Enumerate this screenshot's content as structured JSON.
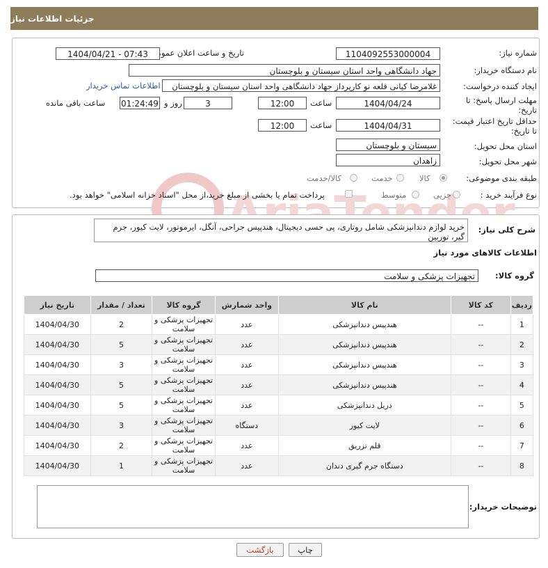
{
  "header": {
    "title": "جزئیات اطلاعات نیاز"
  },
  "form": {
    "need_number_label": "شماره نیاز:",
    "need_number": "1104092553000004",
    "announce_label": "تاریخ و ساعت اعلان عمومی:",
    "announce_value": "1404/04/21 - 07:43",
    "buyer_org_label": "نام دستگاه خریدار:",
    "buyer_org": "جهاد دانشگاهی واحد استان سیستان و بلوچستان",
    "creator_label": "ایجاد کننده درخواست:",
    "creator": "غلامرضا کیانی قلعه نو کارپرداز جهاد دانشگاهی واحد استان سیستان و بلوچستان",
    "contact_link": "اطلاعات تماس خریدار",
    "deadline_label_1": "مهلت ارسال پاسخ: تا",
    "deadline_label_2": "تاریخ:",
    "deadline_date": "1404/04/24",
    "time_label": "ساعت",
    "deadline_time": "12:00",
    "days_value": "3",
    "days_label": "روز و",
    "remaining_time": "01:24:49",
    "remaining_label": "ساعت باقی مانده",
    "min_price_label_1": "حداقل تاریخ اعتبار قیمت:",
    "min_price_label_2": "تا تاریخ:",
    "min_price_date": "1404/04/31",
    "min_price_time": "12:00",
    "province_label": "استان محل تحویل:",
    "province": "سیستان و بلوچستان",
    "city_label": "شهر محل تحویل:",
    "city": "زاهدان",
    "category_label": "طبقه بندی موضوعی:",
    "category_options": [
      "کالا",
      "خدمت",
      "کالا/خدمت"
    ],
    "category_selected": "کالا",
    "process_label": "نوع فرآیند خرید :",
    "process_options": [
      "جزیی",
      "متوسط"
    ],
    "payment_note": "پرداخت تمام یا بخشی از مبلغ خرید،از محل \"اسناد خزانه اسلامی\" خواهد بود."
  },
  "description": {
    "label": "شرح کلی نیاز:",
    "text": "خرید لوازم دندانپزشکی شامل روتاری، پی حسی دیجیتال، هندپیس جراحی، آنگل، ایرموتور، لایت کیور، جرم گیر، توربین"
  },
  "goods": {
    "section_title": "اطلاعات کالاهای مورد نیاز",
    "group_label": "گروه کالا:",
    "group_value": "تجهیزات پزشکی و سلامت",
    "columns": [
      "ردیف",
      "کد کالا",
      "نام کالا",
      "واحد شمارش",
      "گروه کالا",
      "تعداد / مقدار",
      "تاریخ نیاز"
    ],
    "rows": [
      {
        "idx": "1",
        "code": "--",
        "name": "هندپیس دندانپزشکی",
        "unit": "عدد",
        "group": "تجهیزات پزشکی و سلامت",
        "qty": "2",
        "date": "1404/04/30"
      },
      {
        "idx": "2",
        "code": "--",
        "name": "هندپیس دندانپزشکی",
        "unit": "عدد",
        "group": "تجهیزات پزشکی و سلامت",
        "qty": "5",
        "date": "1404/04/30"
      },
      {
        "idx": "3",
        "code": "--",
        "name": "هندپیس دندانپزشکی",
        "unit": "عدد",
        "group": "تجهیزات پزشکی و سلامت",
        "qty": "3",
        "date": "1404/04/30"
      },
      {
        "idx": "4",
        "code": "--",
        "name": "هندپیس دندانپزشکی",
        "unit": "عدد",
        "group": "تجهیزات پزشکی و سلامت",
        "qty": "5",
        "date": "1404/04/30"
      },
      {
        "idx": "5",
        "code": "--",
        "name": "دریل دندانپزشکی",
        "unit": "عدد",
        "group": "تجهیزات پزشکی و سلامت",
        "qty": "5",
        "date": "1404/04/30"
      },
      {
        "idx": "6",
        "code": "--",
        "name": "لایت کیور",
        "unit": "دستگاه",
        "group": "تجهیزات پزشکی و سلامت",
        "qty": "3",
        "date": "1404/04/30"
      },
      {
        "idx": "7",
        "code": "--",
        "name": "قلم تزریق",
        "unit": "عدد",
        "group": "تجهیزات پزشکی و سلامت",
        "qty": "2",
        "date": "1404/04/30"
      },
      {
        "idx": "8",
        "code": "--",
        "name": "دستگاه جرم گیری دندان",
        "unit": "عدد",
        "group": "تجهیزات پزشکی و سلامت",
        "qty": "1",
        "date": "1404/04/30"
      }
    ]
  },
  "buyer_notes": {
    "label": "توضیحات خریدار:",
    "text": ""
  },
  "buttons": {
    "print": "چاپ",
    "back": "بازگشت"
  },
  "watermark_text": "AriaTender.neT",
  "colors": {
    "header_bg": "#8d7d5b",
    "link": "#2a5db0",
    "back_button_text": "#c0392b"
  }
}
